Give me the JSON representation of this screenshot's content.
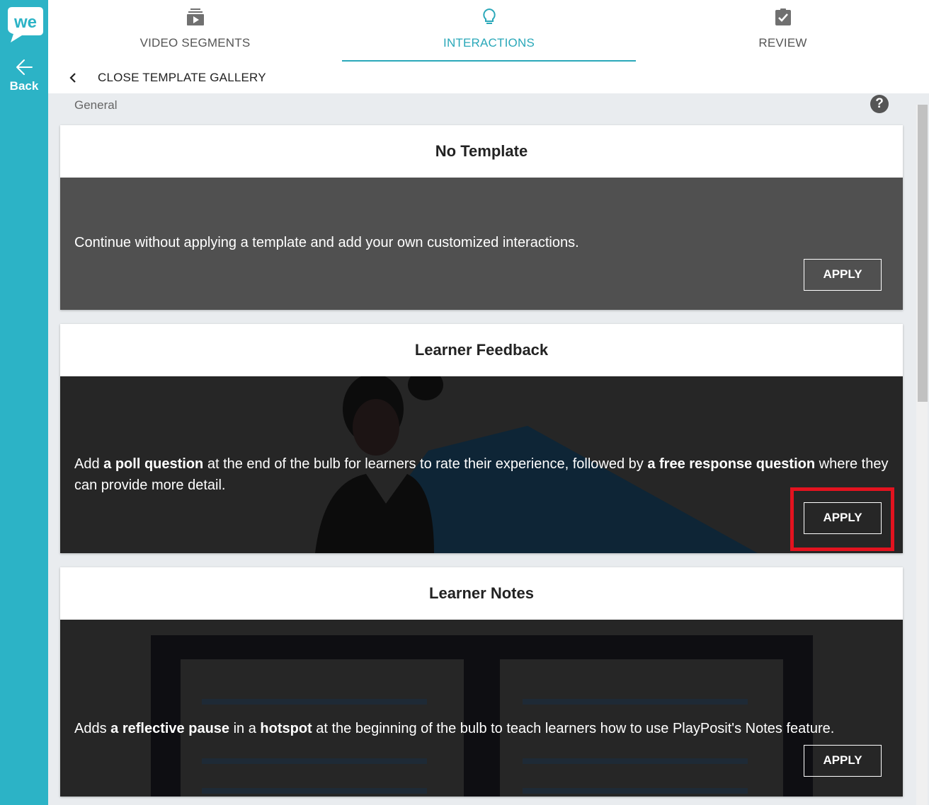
{
  "sidebar": {
    "logo_text": "we",
    "back_label": "Back",
    "accent": "#2cb3c6"
  },
  "tabs": [
    {
      "label": "VIDEO SEGMENTS",
      "icon": "video-stack-icon",
      "active": false
    },
    {
      "label": "INTERACTIONS",
      "icon": "lightbulb-icon",
      "active": true
    },
    {
      "label": "REVIEW",
      "icon": "clipboard-check-icon",
      "active": false
    }
  ],
  "close_gallery": {
    "label": "CLOSE TEMPLATE GALLERY"
  },
  "section": {
    "label": "General",
    "help_icon": "?"
  },
  "cards": [
    {
      "title": "No Template",
      "description": "Continue without applying a template and add your own customized interactions.",
      "apply_label": "APPLY",
      "body_color": "#505050"
    },
    {
      "title": "Learner Feedback",
      "description_parts": [
        "Add ",
        "a poll question",
        " at the end of the bulb for learners to rate their experience, followed by ",
        "a free response question",
        " where they can provide more detail."
      ],
      "apply_label": "APPLY",
      "body_color": "#262626",
      "highlighted": true
    },
    {
      "title": "Learner Notes",
      "description_parts": [
        "Adds ",
        "a reflective pause",
        " in a ",
        "hotspot",
        " at the beginning of the bulb to teach learners how to use PlayPosit's Notes feature."
      ],
      "apply_label": "APPLY",
      "body_color": "#262626"
    }
  ],
  "colors": {
    "active_tab": "#2aa8b9",
    "highlight": "#e3131f"
  }
}
